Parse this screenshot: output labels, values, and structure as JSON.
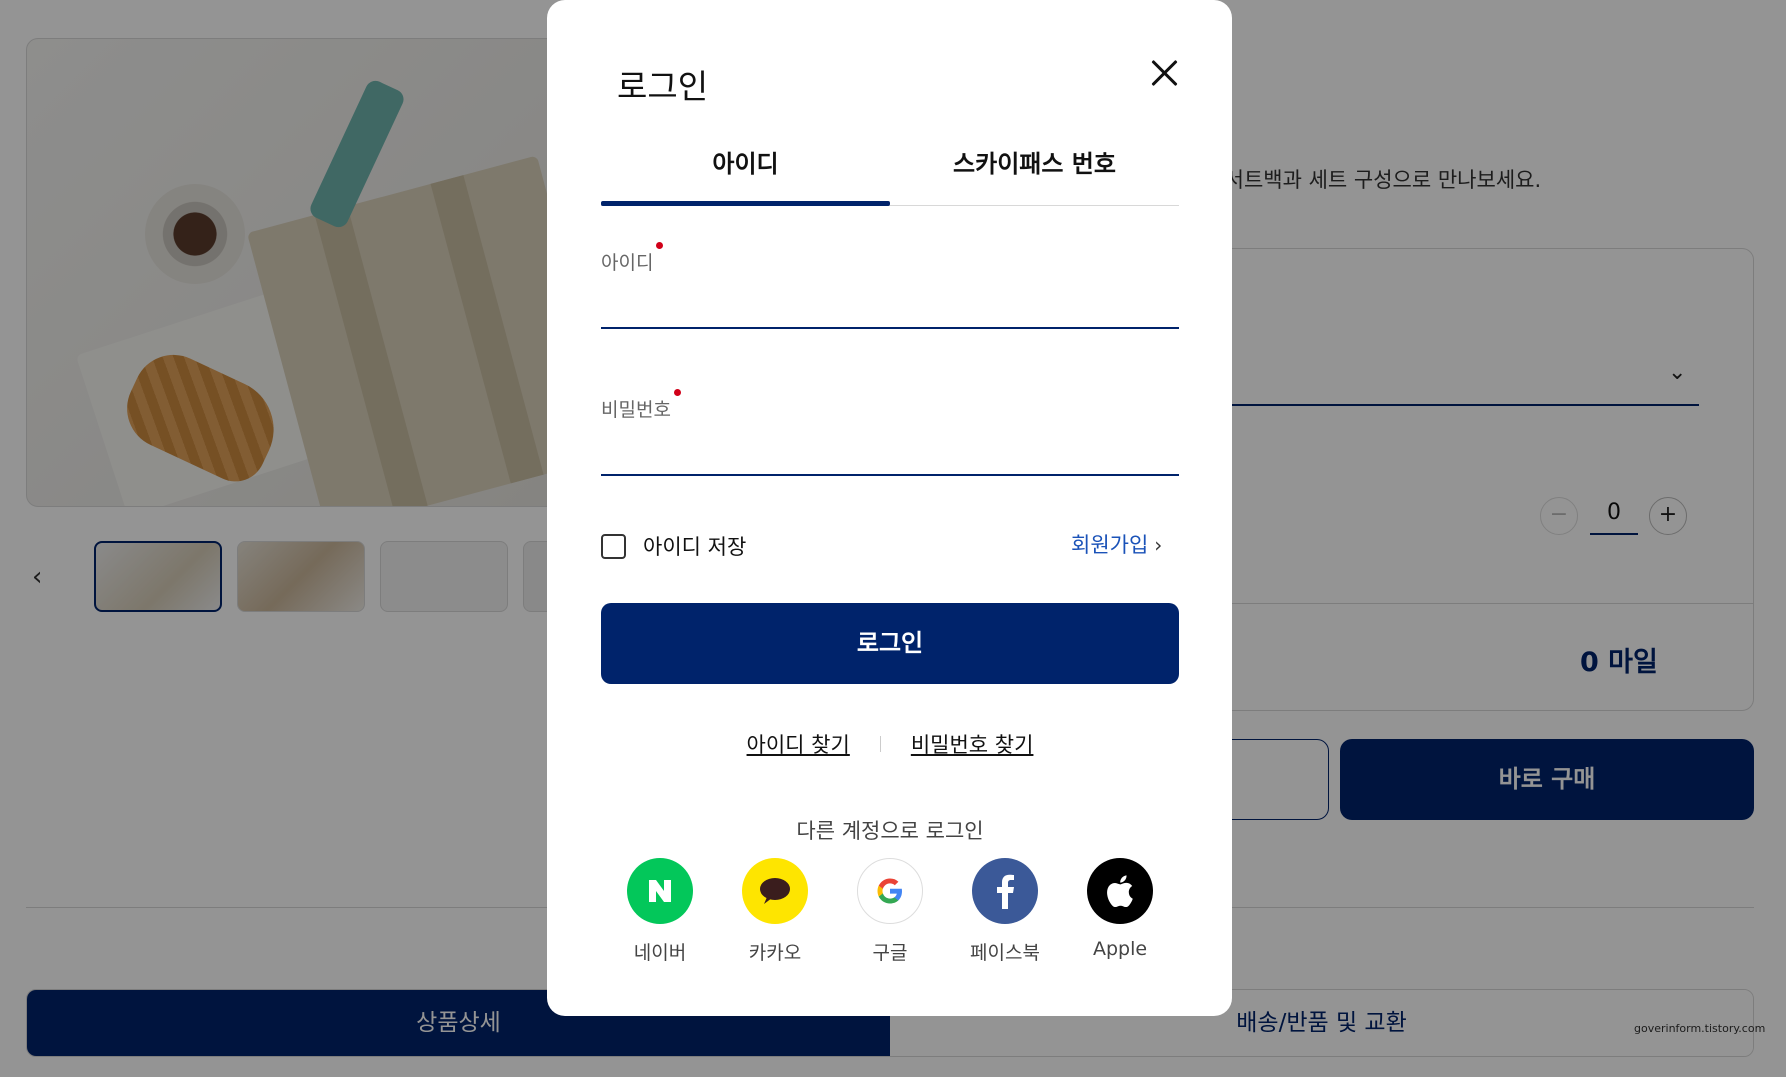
{
  "background": {
    "description_text": "보냉 인서트백과 세트 구성으로 만나보세요.",
    "quantity": "0",
    "total": "0 마일",
    "buy_now": "바로 구매",
    "tabs": [
      "상품상세",
      "배송/반품 및 교환"
    ],
    "watermark": "goverinform.tistory.com"
  },
  "modal": {
    "title": "로그인",
    "tabs": [
      {
        "label": "아이디",
        "active": true
      },
      {
        "label": "스카이패스 번호",
        "active": false
      }
    ],
    "id_label": "아이디",
    "password_label": "비밀번호",
    "remember_label": "아이디 저장",
    "signup_label": "회원가입",
    "login_button": "로그인",
    "find_id": "아이디 찾기",
    "find_password": "비밀번호 찾기",
    "other_login": "다른 계정으로 로그인",
    "social": [
      {
        "name": "네이버",
        "icon": "naver-icon",
        "color": "#03c75a"
      },
      {
        "name": "카카오",
        "icon": "kakao-icon",
        "color": "#fee500"
      },
      {
        "name": "구글",
        "icon": "google-icon",
        "color": "#ffffff"
      },
      {
        "name": "페이스북",
        "icon": "facebook-icon",
        "color": "#3b5998"
      },
      {
        "name": "Apple",
        "icon": "apple-icon",
        "color": "#000000"
      }
    ]
  },
  "colors": {
    "primary": "#00236b",
    "link": "#1a52b8",
    "required_dot": "#d10019"
  }
}
